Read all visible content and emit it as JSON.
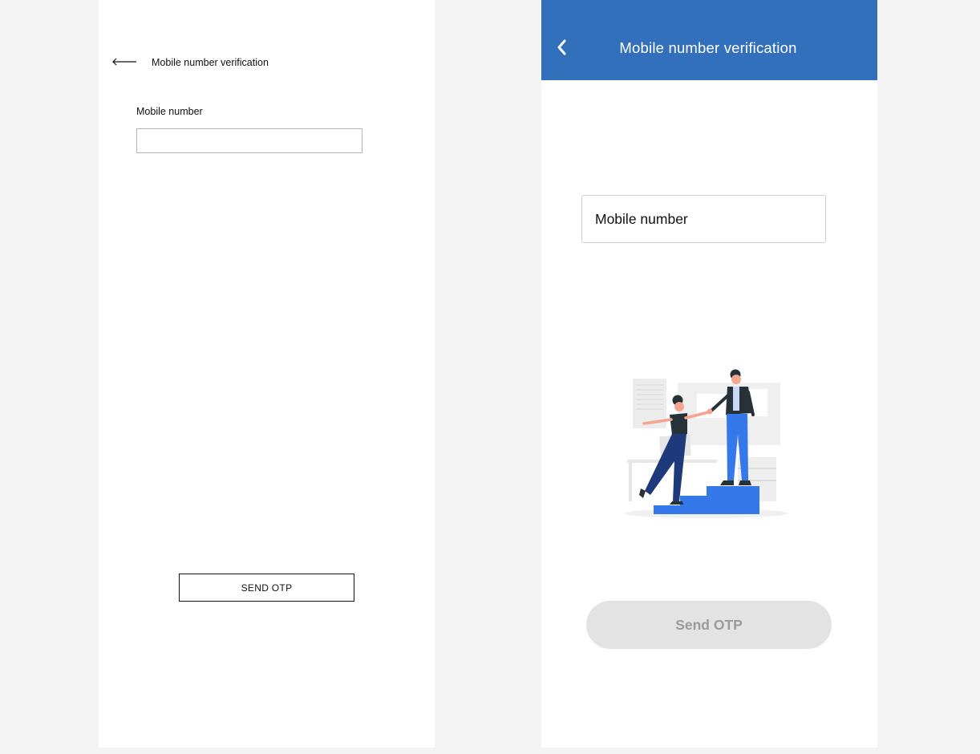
{
  "wireframe": {
    "header": {
      "back_icon": "long-left-arrow-icon",
      "title": "Mobile number verification"
    },
    "form": {
      "field_label": "Mobile number",
      "field_value": ""
    },
    "button": {
      "label": "SEND OTP"
    }
  },
  "design": {
    "appbar": {
      "back_icon": "chevron-left-icon",
      "title": "Mobile number verification",
      "background": "#3370bc"
    },
    "form": {
      "field_label": "Mobile number"
    },
    "illustration": {
      "icon": "people-climbing-stairs-illustration"
    },
    "button": {
      "label": "Send OTP",
      "background": "#e3e3e3",
      "text_color": "#9a9a9a"
    }
  }
}
